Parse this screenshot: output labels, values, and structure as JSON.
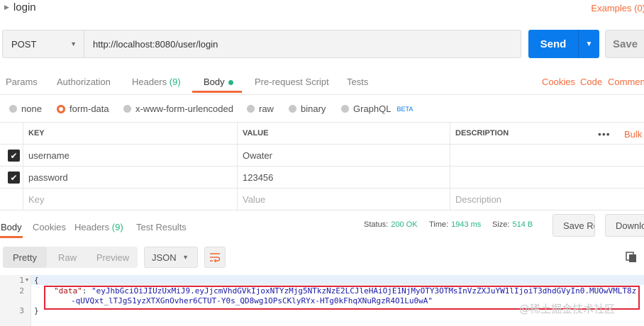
{
  "header": {
    "title": "login",
    "examples_link": "Examples (0)"
  },
  "request": {
    "method": "POST",
    "url": "http://localhost:8080/user/login",
    "send_label": "Send",
    "save_label": "Save"
  },
  "request_tabs": {
    "params": "Params",
    "authorization": "Authorization",
    "headers": "Headers",
    "headers_count": "(9)",
    "body": "Body",
    "prerequest": "Pre-request Script",
    "tests": "Tests",
    "cookies": "Cookies",
    "code": "Code",
    "comments": "Comments"
  },
  "body_types": {
    "none": "none",
    "form_data": "form-data",
    "urlencoded": "x-www-form-urlencoded",
    "raw": "raw",
    "binary": "binary",
    "graphql": "GraphQL",
    "beta": "BETA",
    "selected": "form-data"
  },
  "params_table": {
    "headers": {
      "key": "KEY",
      "value": "VALUE",
      "description": "DESCRIPTION",
      "bulk": "Bulk Edit"
    },
    "rows": [
      {
        "key": "username",
        "value": "Owater",
        "checked": true
      },
      {
        "key": "password",
        "value": "123456",
        "checked": true
      }
    ],
    "placeholder": {
      "key": "Key",
      "value": "Value",
      "description": "Description"
    }
  },
  "response_tabs": {
    "body": "Body",
    "cookies": "Cookies",
    "headers": "Headers",
    "headers_count": "(9)",
    "test_results": "Test Results"
  },
  "response_status": {
    "status_label": "Status:",
    "status_value": "200 OK",
    "time_label": "Time:",
    "time_value": "1943 ms",
    "size_label": "Size:",
    "size_value": "514 B",
    "save": "Save Response",
    "download": "Download"
  },
  "response_view": {
    "pretty": "Pretty",
    "raw": "Raw",
    "preview": "Preview",
    "format": "JSON"
  },
  "response_code": {
    "line_numbers": [
      "1",
      "2",
      "3"
    ],
    "open_brace": "{",
    "close_brace": "}",
    "key": "\"data\"",
    "colon": ": ",
    "value_line1": "\"eyJhbGciOiJIUzUxMiJ9.eyJjcmVhdGVkIjoxNTYzMjg5NTkzNzE2LCJleHAiOjE1NjMyOTY3OTMsInVzZXJuYW1lIjoiT3dhdGVyIn0.MUOwVMLT8z",
    "value_line2": "-qUVQxt_lTJgS1yzXTXGnOvher6CTUT-Y0s_QD8wg1OPsCKlyRYx-HTg0kFhqXNuRgzR4O1Lu0wA\""
  },
  "watermark": "@稀土掘金技术社区"
}
